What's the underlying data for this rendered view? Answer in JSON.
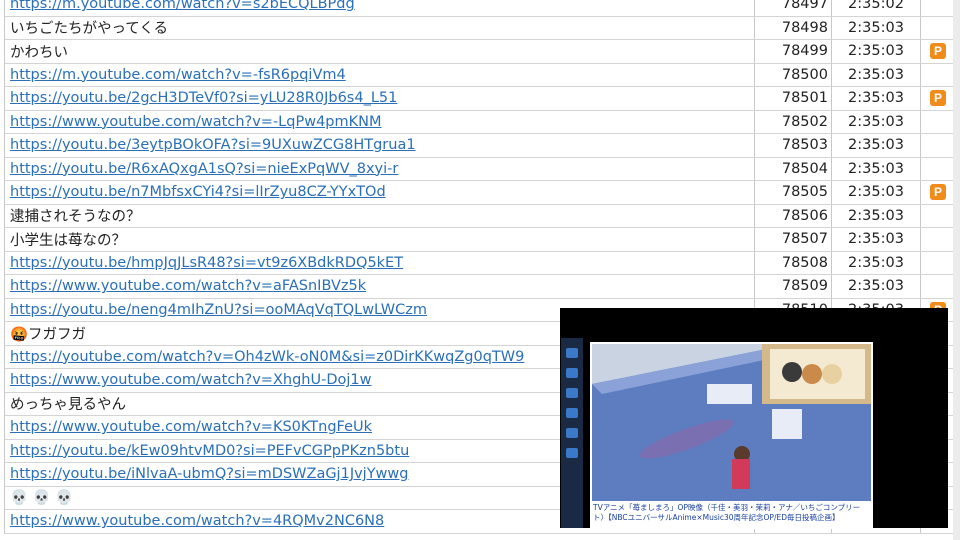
{
  "colors": {
    "link": "#2a6fb8",
    "badge": "#f08c1a",
    "grid_line": "#d4d4d4"
  },
  "rows": [
    {
      "text": "https://m.youtube.com/watch?v=s2bECQLBPdg",
      "link": true,
      "num": "78497",
      "time": "2:35:02",
      "badge": false
    },
    {
      "text": "いちごたちがやってくる",
      "link": false,
      "num": "78498",
      "time": "2:35:03",
      "badge": false
    },
    {
      "text": "かわちい",
      "link": false,
      "num": "78499",
      "time": "2:35:03",
      "badge": true
    },
    {
      "text": "https://m.youtube.com/watch?v=-fsR6pqiVm4",
      "link": true,
      "num": "78500",
      "time": "2:35:03",
      "badge": false
    },
    {
      "text": "https://youtu.be/2gcH3DTeVf0?si=yLU28R0Jb6s4_L51",
      "link": true,
      "num": "78501",
      "time": "2:35:03",
      "badge": true
    },
    {
      "text": "https://www.youtube.com/watch?v=-LqPw4pmKNM",
      "link": true,
      "num": "78502",
      "time": "2:35:03",
      "badge": false
    },
    {
      "text": "https://youtu.be/3eytpBOkOFA?si=9UXuwZCG8HTgrua1",
      "link": true,
      "num": "78503",
      "time": "2:35:03",
      "badge": false
    },
    {
      "text": "https://youtu.be/R6xAQxgA1sQ?si=nieExPqWV_8xyi-r",
      "link": true,
      "num": "78504",
      "time": "2:35:03",
      "badge": false
    },
    {
      "text": "https://youtu.be/n7MbfsxCYi4?si=lIrZyu8CZ-YYxTOd",
      "link": true,
      "num": "78505",
      "time": "2:35:03",
      "badge": true
    },
    {
      "text": "逮捕されそうなの？",
      "link": false,
      "num": "78506",
      "time": "2:35:03",
      "badge": false
    },
    {
      "text": "小学生は苺なの？",
      "link": false,
      "num": "78507",
      "time": "2:35:03",
      "badge": false
    },
    {
      "text": "https://youtu.be/hmpJqJLsR48?si=vt9z6XBdkRDQ5kET",
      "link": true,
      "num": "78508",
      "time": "2:35:03",
      "badge": false
    },
    {
      "text": "https://www.youtube.com/watch?v=aFASnIBVz5k",
      "link": true,
      "num": "78509",
      "time": "2:35:03",
      "badge": false
    },
    {
      "text": "https://youtu.be/neng4mIhZnU?si=ooMAqVqTQLwLWCzm",
      "link": true,
      "num": "78510",
      "time": "2:35:03",
      "badge": true
    },
    {
      "text": "🤬フガフガ",
      "link": false,
      "num": "",
      "time": "",
      "badge": false
    },
    {
      "text": "https://youtube.com/watch?v=Oh4zWk-oN0M&si=z0DirKKwqZg0qTW9",
      "link": true,
      "num": "",
      "time": "",
      "badge": false
    },
    {
      "text": "https://www.youtube.com/watch?v=XhghU-Doj1w",
      "link": true,
      "num": "",
      "time": "",
      "badge": false
    },
    {
      "text": "めっちゃ見るやん",
      "link": false,
      "num": "",
      "time": "",
      "badge": false
    },
    {
      "text": "https://www.youtube.com/watch?v=KS0KTngFeUk",
      "link": true,
      "num": "",
      "time": "",
      "badge": false
    },
    {
      "text": "https://youtu.be/kEw09htvMD0?si=PEFvCGPpPKzn5btu",
      "link": true,
      "num": "",
      "time": "",
      "badge": false
    },
    {
      "text": "https://youtu.be/iNlvaA-ubmQ?si=mDSWZaGj1JvjYwwg",
      "link": true,
      "num": "",
      "time": "",
      "badge": false
    },
    {
      "text": "💀 💀 💀",
      "link": false,
      "num": "",
      "time": "",
      "badge": false
    },
    {
      "text": "https://www.youtube.com/watch?v=4RQMv2NC6N8",
      "link": true,
      "num": "",
      "time": "",
      "badge": false
    }
  ],
  "badge_label": "P",
  "video": {
    "caption": "TVアニメ「苺ましまろ」OP映像（千佳・美羽・茉莉・アナ／いちごコンプリート）【NBCユニバーサルAnime×Music30周年記念OP/ED毎日投稿企画】"
  }
}
